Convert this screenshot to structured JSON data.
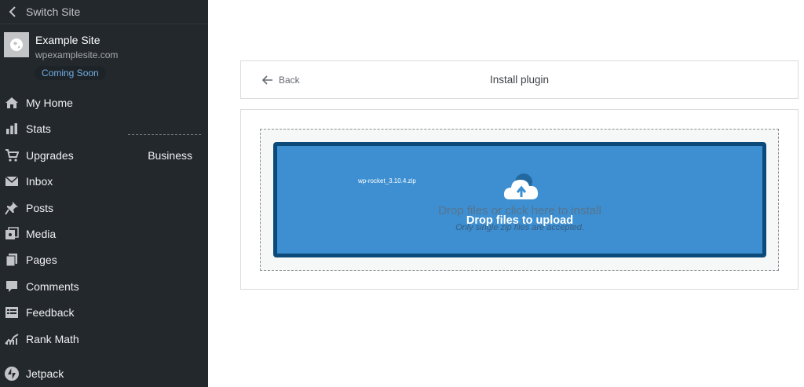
{
  "sidebar": {
    "switch_site": "Switch Site",
    "site": {
      "name": "Example Site",
      "url": "wpexamplesite.com",
      "badge": "Coming Soon"
    },
    "menu": [
      {
        "label": "My Home",
        "icon": "home-icon"
      },
      {
        "label": "Stats",
        "icon": "stats-icon"
      },
      {
        "label": "Upgrades",
        "icon": "cart-icon",
        "extra": "Business"
      },
      {
        "label": "Inbox",
        "icon": "mail-icon"
      },
      {
        "label": "Posts",
        "icon": "pin-icon"
      },
      {
        "label": "Media",
        "icon": "media-icon"
      },
      {
        "label": "Pages",
        "icon": "pages-icon"
      },
      {
        "label": "Comments",
        "icon": "comment-icon"
      },
      {
        "label": "Feedback",
        "icon": "feedback-icon"
      },
      {
        "label": "Rank Math",
        "icon": "rank-math-icon"
      }
    ],
    "jetpack": {
      "label": "Jetpack",
      "icon": "jetpack-icon"
    }
  },
  "header": {
    "back_label": "Back",
    "title": "Install plugin"
  },
  "upload": {
    "ghost_text": "Drop files or click here to install",
    "ghost_subtext": "Only single zip files are accepted.",
    "file_name": "wp-rocket_3.10.4.zip",
    "drop_label": "Drop files to upload"
  },
  "colors": {
    "sidebar_bg": "#23282d",
    "drop_bg": "#3d8fd1",
    "drop_border": "#0c4a79",
    "badge_text": "#72aee6"
  }
}
